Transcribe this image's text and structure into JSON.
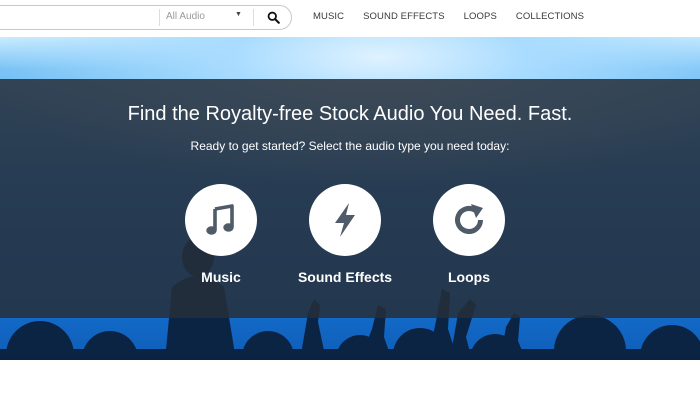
{
  "search": {
    "value": "",
    "placeholder": "",
    "filter_selected": "All Audio",
    "caret_icon": "caret-down-icon",
    "button_icon": "magnifier-icon"
  },
  "nav": {
    "items": [
      {
        "label": "MUSIC"
      },
      {
        "label": "SOUND EFFECTS"
      },
      {
        "label": "LOOPS"
      },
      {
        "label": "COLLECTIONS"
      }
    ]
  },
  "hero": {
    "title": "Find the Royalty-free Stock Audio You Need. Fast.",
    "subtitle": "Ready to get started? Select the audio type you need today:",
    "categories": [
      {
        "label": "Music",
        "icon": "music-note-icon"
      },
      {
        "label": "Sound Effects",
        "icon": "lightning-bolt-icon"
      },
      {
        "label": "Loops",
        "icon": "refresh-icon"
      }
    ]
  },
  "colors": {
    "overlay": "#262e3a",
    "icon": "#4f5b69",
    "background_blue": "#1675d4",
    "text_light": "#ffffff",
    "nav_text": "#3a3a3a"
  }
}
